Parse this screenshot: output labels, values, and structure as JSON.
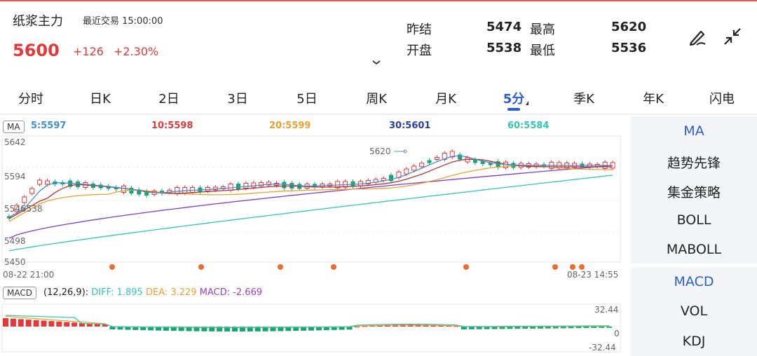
{
  "header": {
    "title": "纸浆主力",
    "last_trade": "最近交易  15:00:00",
    "price": "5600",
    "change": "+126",
    "change_pct": "+2.30%"
  },
  "quote": {
    "prev_settle_label": "昨结",
    "prev_settle": "5474",
    "open_label": "开盘",
    "open": "5538",
    "high_label": "最高",
    "high": "5620",
    "low_label": "最低",
    "low": "5536"
  },
  "tabs": [
    "分时",
    "日K",
    "2日",
    "3日",
    "5日",
    "周K",
    "月K",
    "5分",
    "季K",
    "年K",
    "闪电"
  ],
  "active_tab": "5分",
  "ma_badge": "MA",
  "ma_values": [
    {
      "label": "5:5597",
      "color": "#3d8fd6"
    },
    {
      "label": "10:5598",
      "color": "#e5383b"
    },
    {
      "label": "20:5599",
      "color": "#f0a030"
    },
    {
      "label": "30:5601",
      "color": "#2a3fa8"
    },
    {
      "label": "60:5584",
      "color": "#30c8b0"
    }
  ],
  "y_labels": {
    "top": "5642",
    "mid1": "5594",
    "mid2": "5538",
    "mid2b": "5546",
    "mid3": "5498",
    "bottom": "5450"
  },
  "high_marker": "5620",
  "x_labels": {
    "start": "08-22 21:00",
    "end": "08-23 14:55"
  },
  "macd": {
    "badge": "MACD",
    "params": "(12,26,9):",
    "diff": "DIFF: 1.895",
    "dea": "DEA: 3.229",
    "macd": "MACD: -2.669",
    "diff_color": "#30c8b0",
    "dea_color": "#f0a030",
    "macd_color": "#9b3fc8",
    "y_top": "32.44",
    "y_zero": "0",
    "y_bottom": "-32.44"
  },
  "side_items": [
    "MA",
    "趋势先锋",
    "集金策略",
    "BOLL",
    "MABOLL",
    "MACD",
    "VOL",
    "KDJ"
  ],
  "side_active": [
    "MA",
    "MACD"
  ],
  "colors": {
    "up": "#e5383b",
    "down": "#17a673",
    "accent": "#2b5fce"
  },
  "icons": [
    "draw-tool-icon",
    "collapse-icon",
    "chevron-down-icon"
  ]
}
